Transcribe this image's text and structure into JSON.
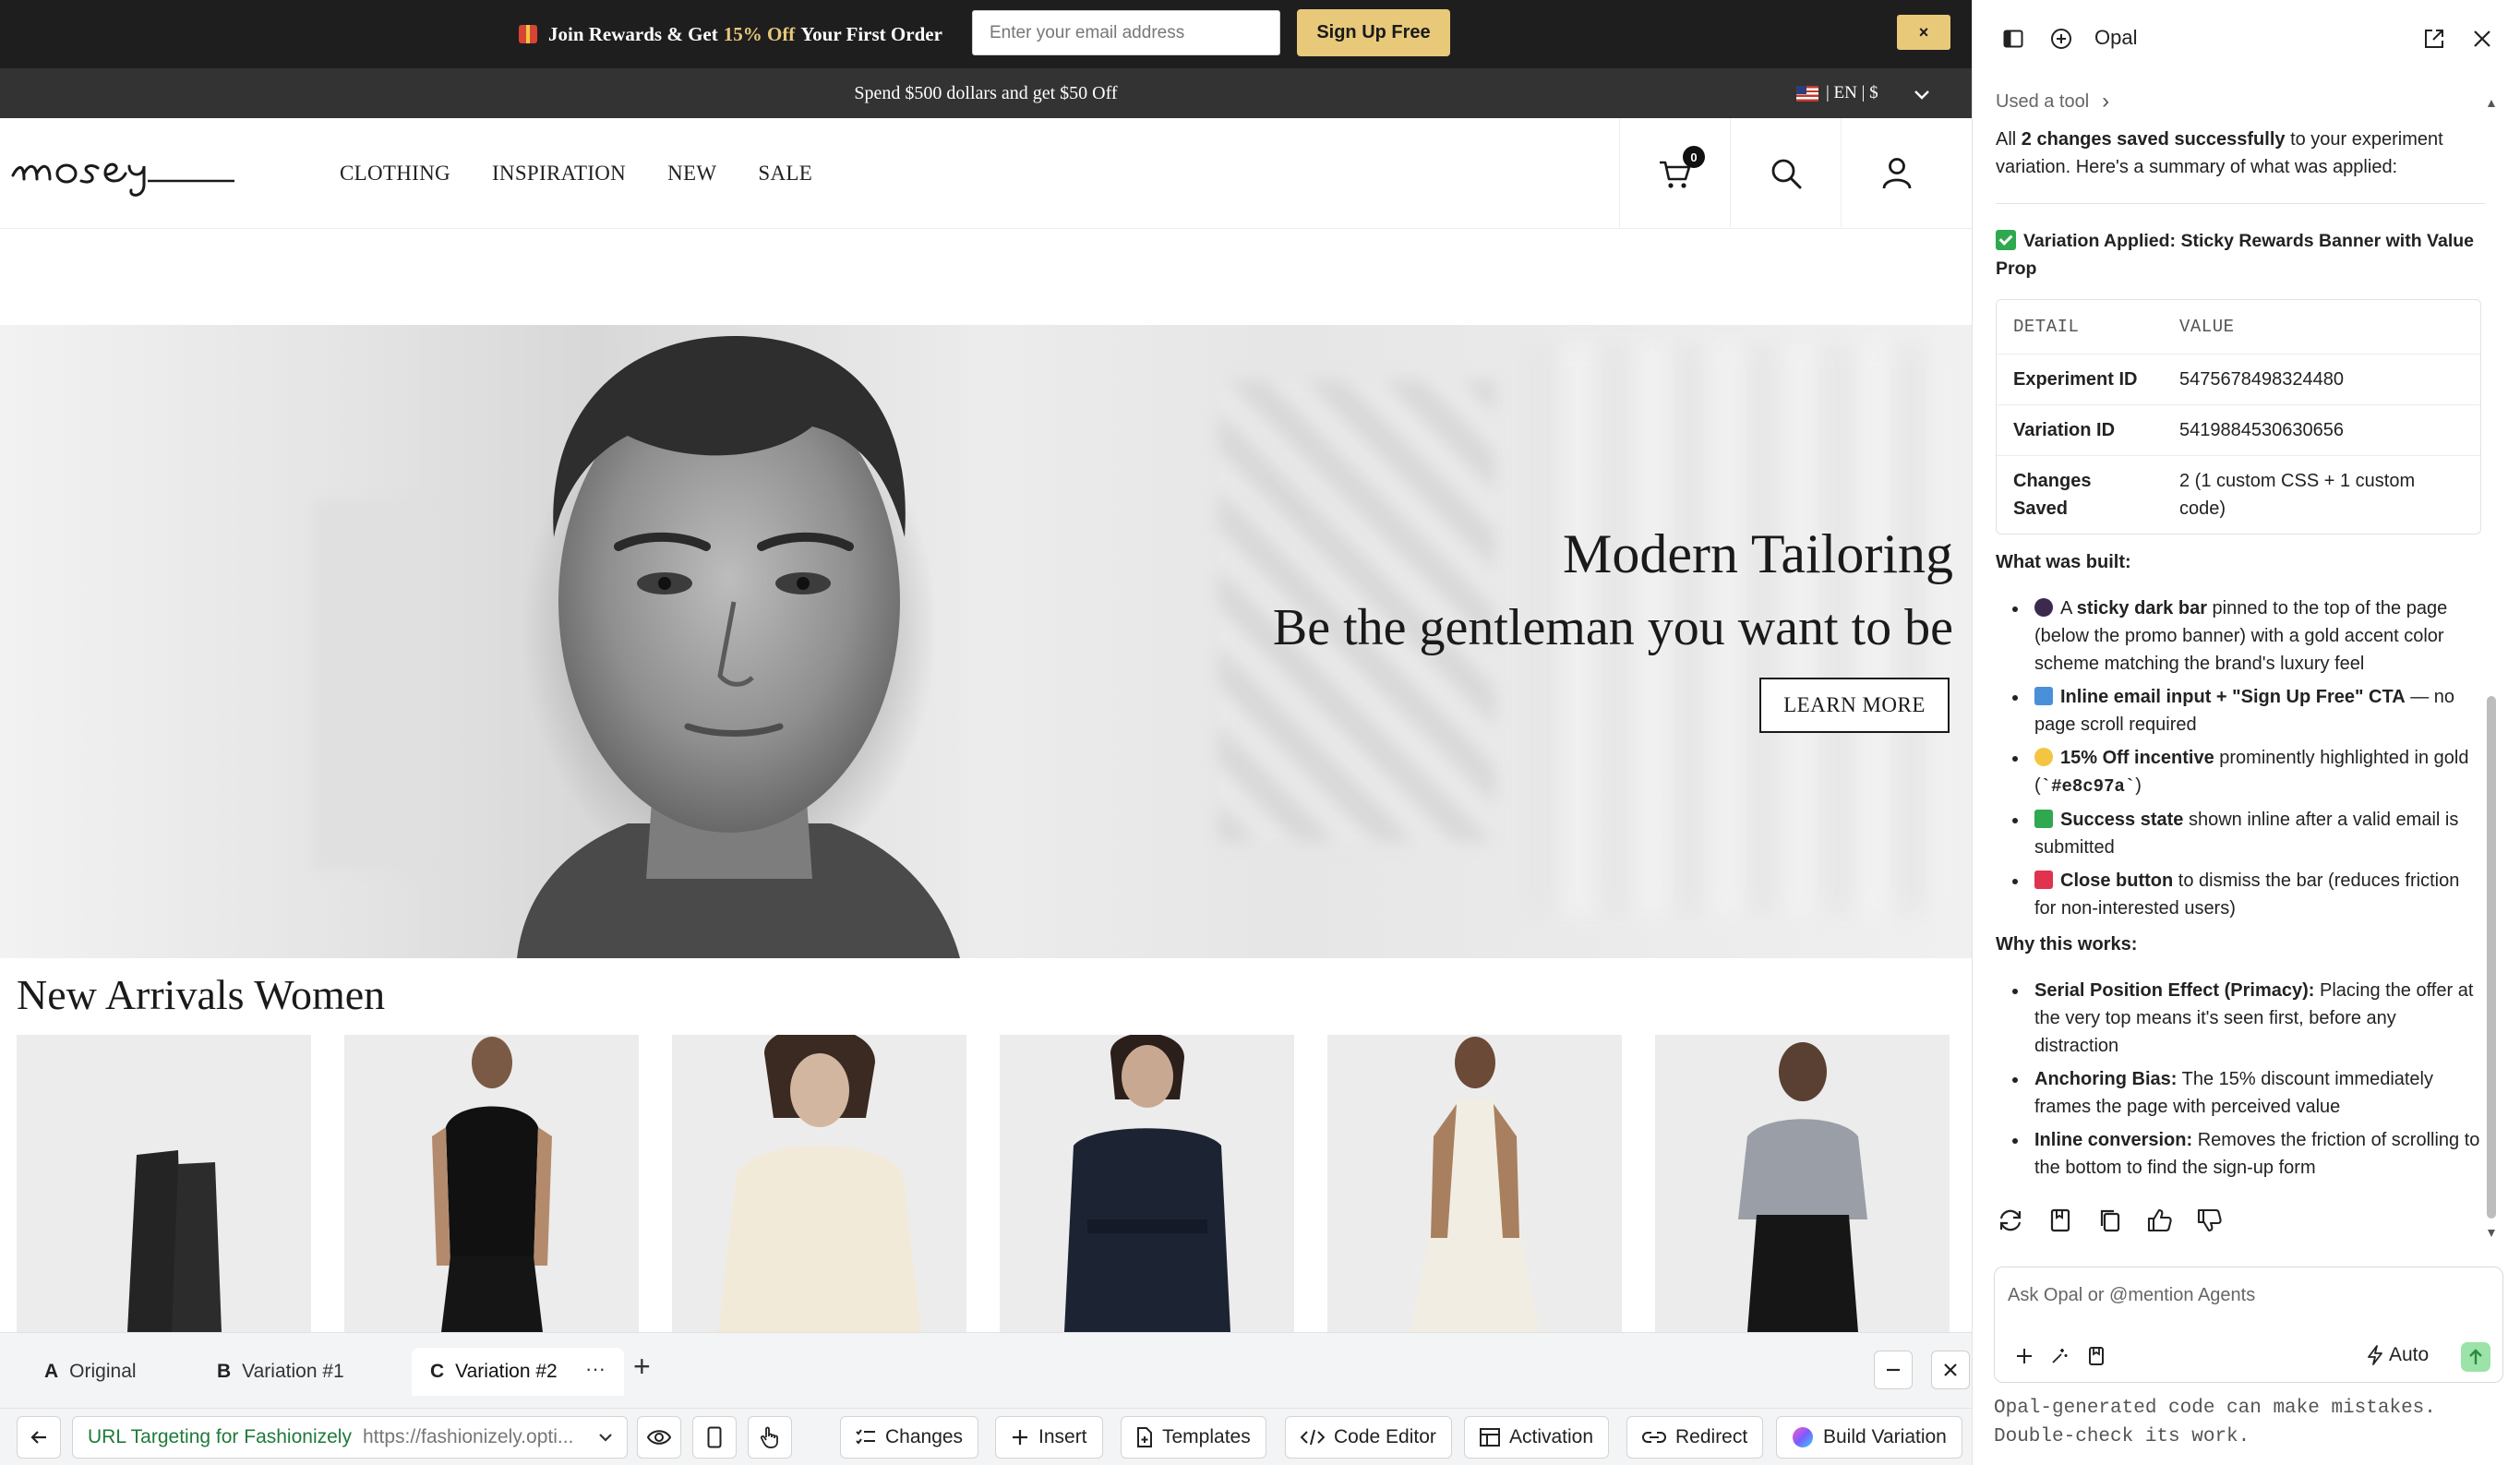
{
  "promo": {
    "text_before": "Join Rewards & Get",
    "text_accent": "15% Off",
    "text_after": "Your First Order",
    "email_placeholder": "Enter your email address",
    "signup_label": "Sign Up Free",
    "close_label": "×"
  },
  "subbar": {
    "text": "Spend $500 dollars and get $50 Off",
    "locale": "| EN | $"
  },
  "nav": {
    "logo_text": "mosey",
    "menu": [
      "CLOTHING",
      "INSPIRATION",
      "NEW",
      "SALE"
    ],
    "cart_count": "0",
    "icons": [
      "cart-icon",
      "search-icon",
      "user-icon"
    ]
  },
  "hero": {
    "title": "Modern Tailoring",
    "subtitle": "Be the gentleman you want to be",
    "cta": "LEARN MORE"
  },
  "arrivals": {
    "title": "New Arrivals Women"
  },
  "editor": {
    "tabs": [
      {
        "letter": "A",
        "label": "Original"
      },
      {
        "letter": "B",
        "label": "Variation #1"
      },
      {
        "letter": "C",
        "label": "Variation #2"
      }
    ],
    "more_label": "···",
    "add_label": "+",
    "url_name": "URL Targeting for Fashionizely",
    "url_value": "https://fashionizely.opti...",
    "toolbar": {
      "changes": "Changes",
      "insert": "Insert",
      "templates": "Templates",
      "code_editor": "Code Editor",
      "activation": "Activation",
      "redirect": "Redirect",
      "build": "Build Variation"
    }
  },
  "panel": {
    "title": "Opal",
    "used_tool": "Used a tool",
    "intro_1": "All ",
    "intro_bold": "2 changes saved successfully",
    "intro_2": " to your experiment variation. Here's a summary of what was applied:",
    "applied": "Variation Applied: Sticky Rewards Banner with Value Prop",
    "table": {
      "headers": [
        "DETAIL",
        "VALUE"
      ],
      "rows": [
        {
          "k": "Experiment ID",
          "v": "5475678498324480"
        },
        {
          "k": "Variation ID",
          "v": "5419884530630656"
        },
        {
          "k": "Changes Saved",
          "v": "2 (1 custom CSS + 1 custom code)"
        }
      ]
    },
    "built_title": "What was built:",
    "built": [
      {
        "bold": "sticky dark bar",
        "pre": "A ",
        "post": " pinned to the top of the page (below the promo banner) with a gold accent color scheme matching the brand's luxury feel"
      },
      {
        "bold": "Inline email input + \"Sign Up Free\" CTA",
        "pre": "",
        "post": " — no page scroll required"
      },
      {
        "bold": "15% Off incentive",
        "pre": "",
        "post": " prominently highlighted in gold (",
        "code": "`#e8c97a`",
        "tail": ")"
      },
      {
        "bold": "Success state",
        "pre": "",
        "post": " shown inline after a valid email is submitted"
      },
      {
        "bold": "Close button",
        "pre": "",
        "post": " to dismiss the bar (reduces friction for non-interested users)"
      }
    ],
    "why_title": "Why this works:",
    "why": [
      {
        "bold": "Serial Position Effect (Primacy):",
        "post": " Placing the offer at the very top means it's seen first, before any distraction"
      },
      {
        "bold": "Anchoring Bias:",
        "post": " The 15% discount immediately frames the page with perceived value"
      },
      {
        "bold": "Inline conversion:",
        "post": " Removes the friction of scrolling to the bottom to find the sign-up form"
      }
    ],
    "composer_placeholder": "Ask Opal or @mention Agents",
    "mode": "Auto",
    "disclaimer": "Opal-generated code can make mistakes. Double-check its work."
  },
  "colors": {
    "gold": "#e8c97a",
    "promo_bg": "#1e1e1e",
    "subbar_bg": "#333333",
    "url_green": "#1f7a3a"
  }
}
